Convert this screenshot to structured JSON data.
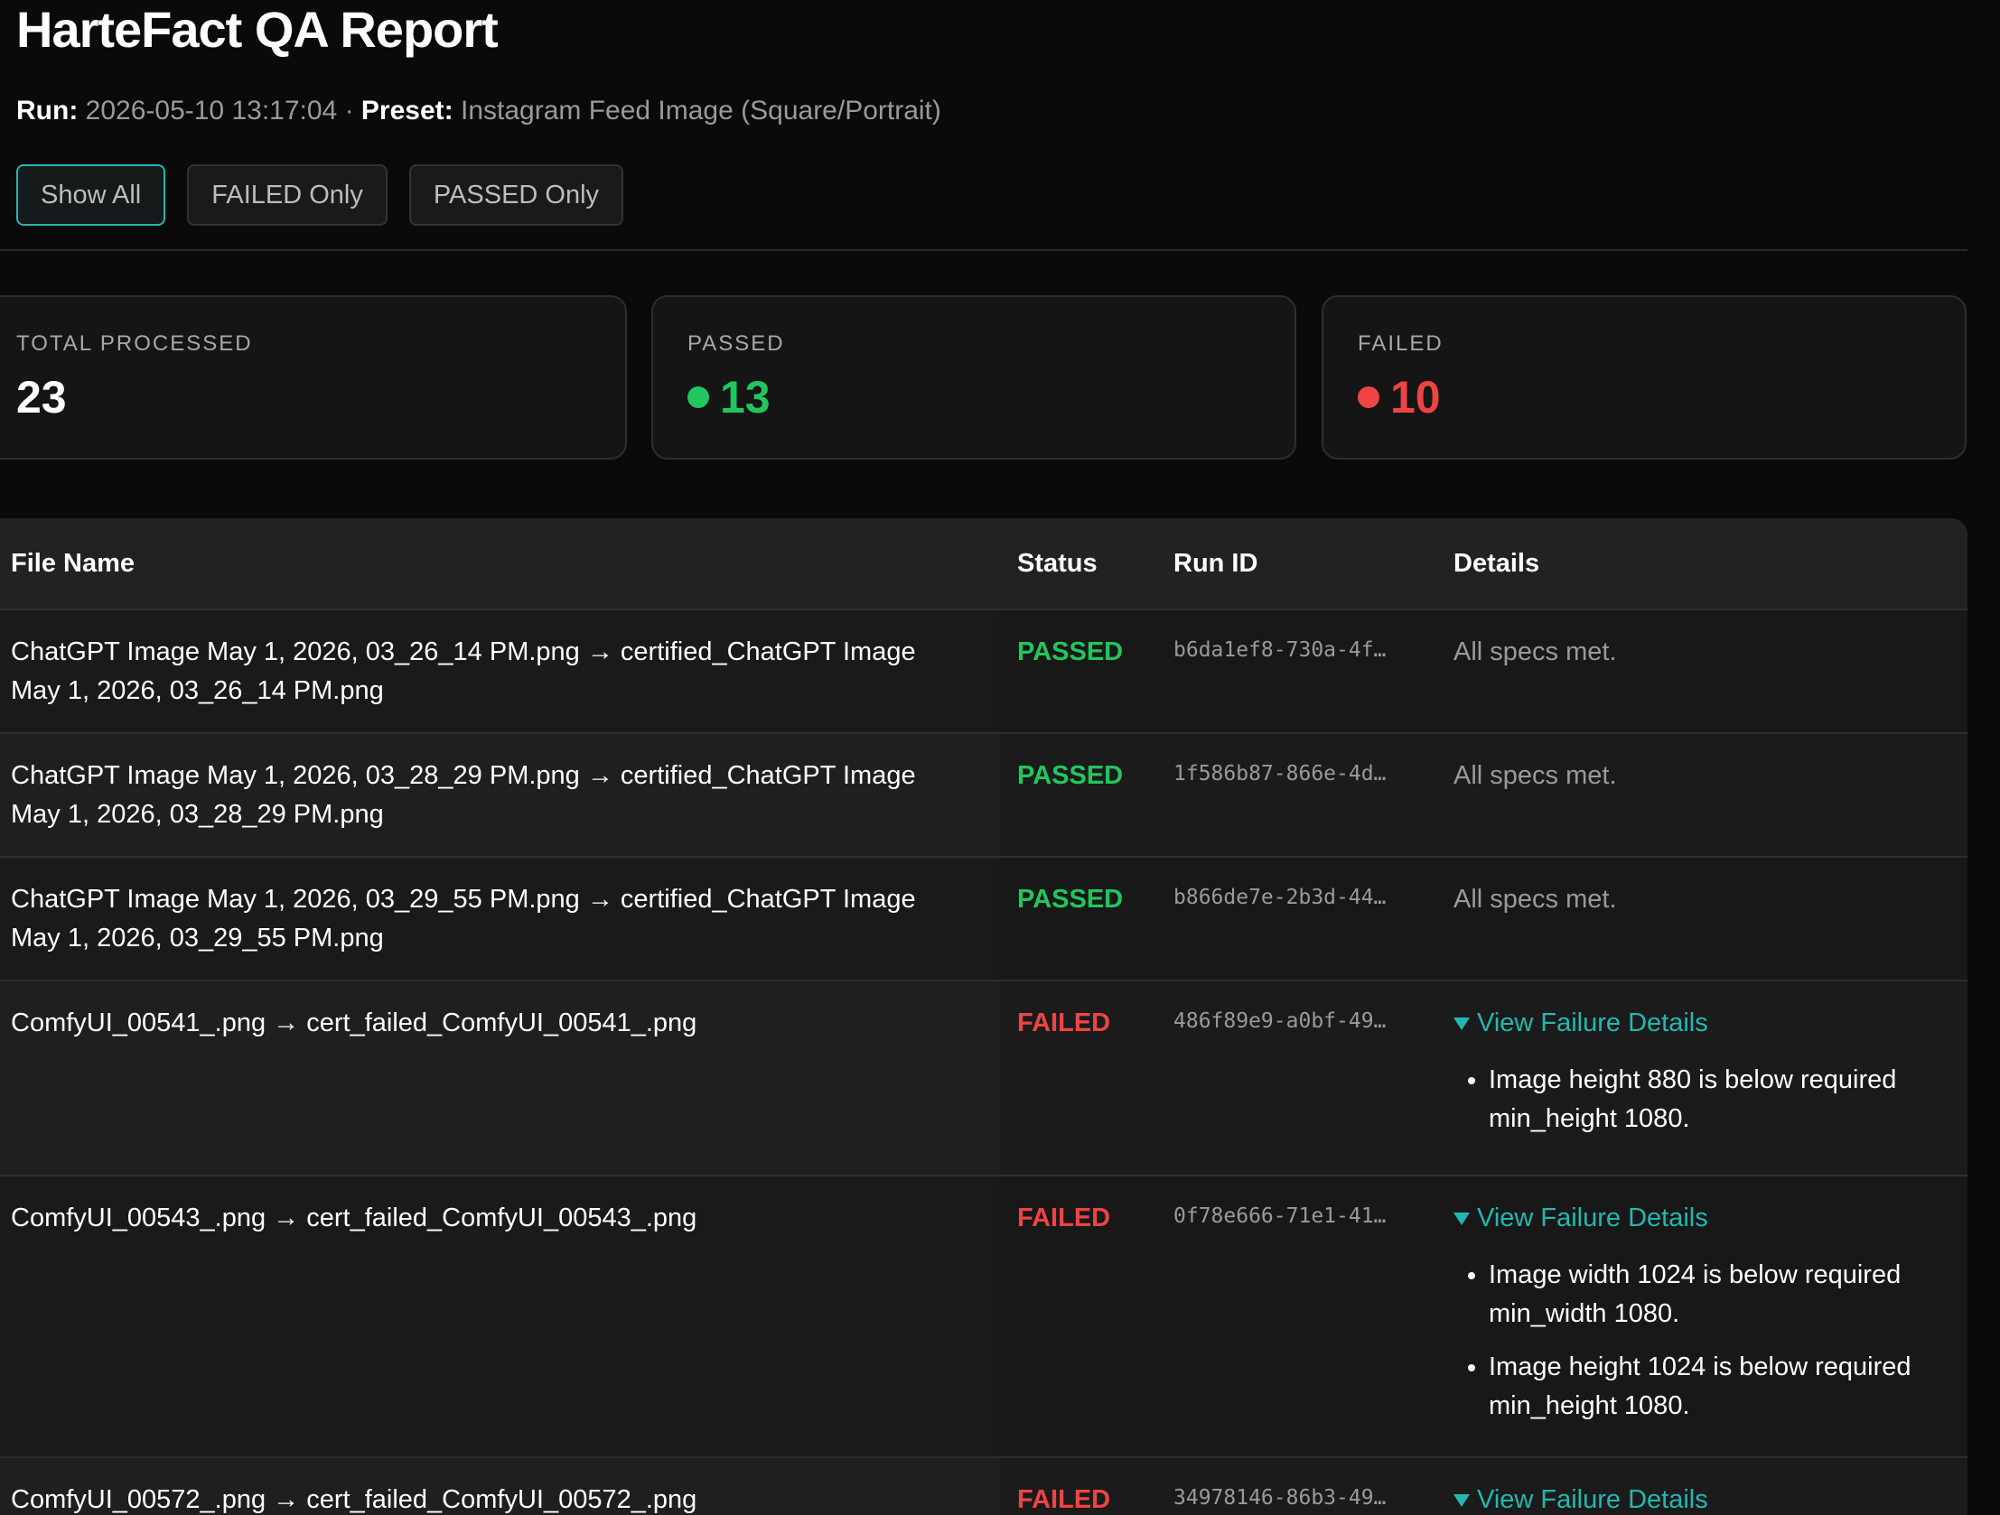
{
  "header": {
    "title": "HarteFact QA Report",
    "run_label": "Run:",
    "run_value": "2026-05-10 13:17:04",
    "separator": "·",
    "preset_label": "Preset:",
    "preset_value": "Instagram Feed Image (Square/Portrait)"
  },
  "filters": [
    {
      "label": "Show All",
      "active": true
    },
    {
      "label": "FAILED Only",
      "active": false
    },
    {
      "label": "PASSED Only",
      "active": false
    }
  ],
  "stats": {
    "total": {
      "label": "TOTAL PROCESSED",
      "value": "23"
    },
    "passed": {
      "label": "PASSED",
      "value": "13",
      "color": "#22c55e"
    },
    "failed": {
      "label": "FAILED",
      "value": "10",
      "color": "#ef4444"
    }
  },
  "table": {
    "columns": [
      "File Name",
      "Status",
      "Run ID",
      "Details"
    ],
    "rows": [
      {
        "file": "ChatGPT Image May 1, 2026, 03_26_14 PM.png → certified_ChatGPT Image May 1, 2026, 03_26_14 PM.png",
        "status": "PASSED",
        "run_id": "b6da1ef8-730a-4f…",
        "details": "All specs met."
      },
      {
        "file": "ChatGPT Image May 1, 2026, 03_28_29 PM.png → certified_ChatGPT Image May 1, 2026, 03_28_29 PM.png",
        "status": "PASSED",
        "run_id": "1f586b87-866e-4d…",
        "details": "All specs met."
      },
      {
        "file": "ChatGPT Image May 1, 2026, 03_29_55 PM.png → certified_ChatGPT Image May 1, 2026, 03_29_55 PM.png",
        "status": "PASSED",
        "run_id": "b866de7e-2b3d-44…",
        "details": "All specs met."
      },
      {
        "file": "ComfyUI_00541_.png → cert_failed_ComfyUI_00541_.png",
        "status": "FAILED",
        "run_id": "486f89e9-a0bf-49…",
        "details_toggle": "View Failure Details",
        "failures": [
          "Image height 880 is below required min_height 1080."
        ]
      },
      {
        "file": "ComfyUI_00543_.png → cert_failed_ComfyUI_00543_.png",
        "status": "FAILED",
        "run_id": "0f78e666-71e1-41…",
        "details_toggle": "View Failure Details",
        "failures": [
          "Image width 1024 is below required min_width 1080.",
          "Image height 1024 is below required min_height 1080."
        ]
      },
      {
        "file": "ComfyUI_00572_.png → cert_failed_ComfyUI_00572_.png",
        "status": "FAILED",
        "run_id": "34978146-86b3-49…",
        "details_toggle": "View Failure Details"
      }
    ]
  },
  "colors": {
    "accent": "#22b8b0",
    "passed": "#22c55e",
    "failed": "#ef4444"
  }
}
